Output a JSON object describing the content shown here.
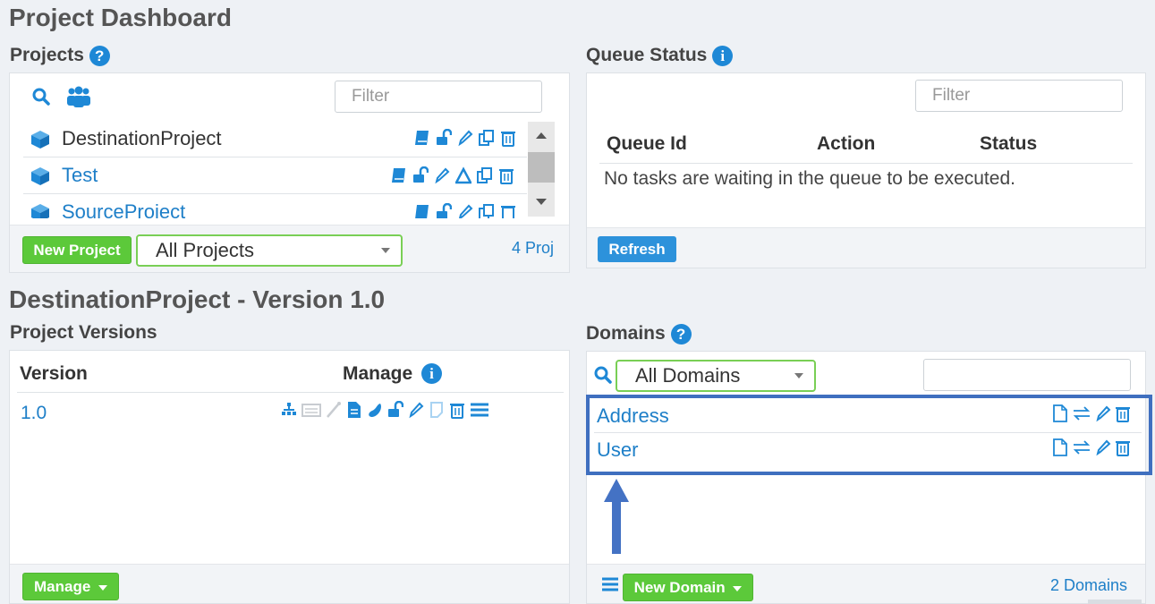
{
  "page": {
    "title": "Project Dashboard"
  },
  "projects": {
    "heading": "Projects",
    "filter_placeholder": "Filter",
    "items": [
      {
        "name": "DestinationProject"
      },
      {
        "name": "Test"
      },
      {
        "name": "SourceProject"
      }
    ],
    "new_button": "New Project",
    "select_value": "All Projects",
    "count": "4 Proj"
  },
  "queue": {
    "heading": "Queue Status",
    "filter_placeholder": "Filter",
    "columns": [
      "Queue Id",
      "Action",
      "Status"
    ],
    "empty_message": "No tasks are waiting in the queue to be executed.",
    "refresh_button": "Refresh"
  },
  "version_section": {
    "title": "DestinationProject - Version 1.0"
  },
  "versions": {
    "heading": "Project Versions",
    "columns": [
      "Version",
      "Manage"
    ],
    "rows": [
      {
        "version": "1.0"
      }
    ],
    "manage_button": "Manage"
  },
  "domains": {
    "heading": "Domains",
    "select_value": "All Domains",
    "items": [
      {
        "name": "Address"
      },
      {
        "name": "User"
      }
    ],
    "new_button": "New Domain",
    "count": "2 Domains"
  },
  "colors": {
    "accent": "#1e88d6",
    "green": "#5cc93a",
    "highlight": "#3f6fbf"
  }
}
